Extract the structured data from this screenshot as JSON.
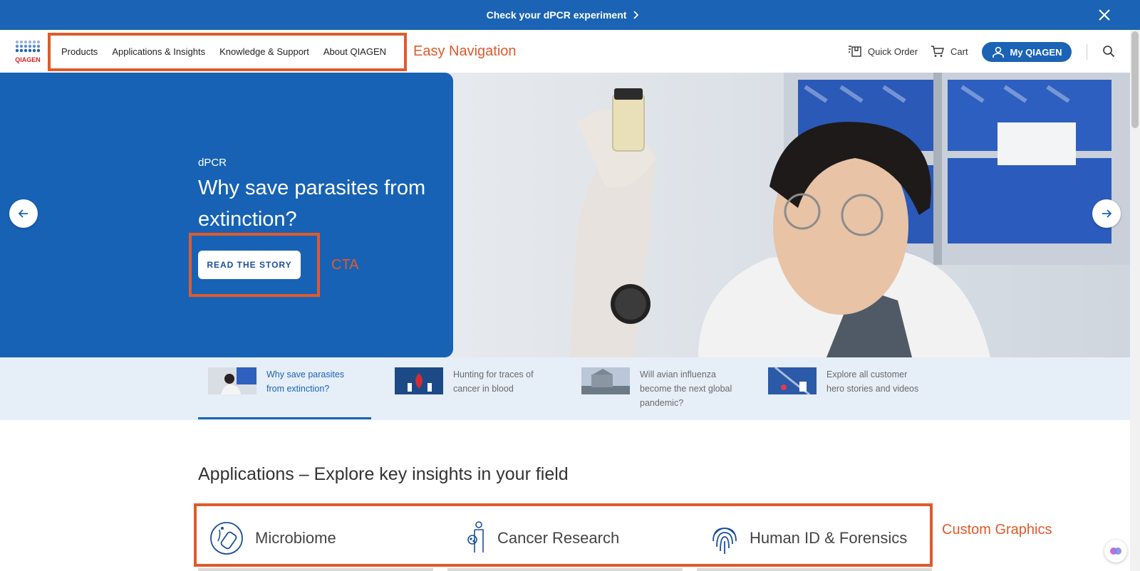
{
  "announcement": {
    "text": "Check your dPCR experiment"
  },
  "brand": {
    "logo_text": "QIAGEN",
    "primary": "#1b63b5",
    "annotation": "#e05a2b"
  },
  "nav": {
    "items": [
      {
        "label": "Products"
      },
      {
        "label": "Applications & Insights"
      },
      {
        "label": "Knowledge & Support"
      },
      {
        "label": "About QIAGEN"
      }
    ]
  },
  "header": {
    "quick_order": "Quick Order",
    "cart": "Cart",
    "my_account": "My QIAGEN"
  },
  "annotations": {
    "navigation": "Easy Navigation",
    "cta": "CTA",
    "graphics": "Custom Graphics"
  },
  "hero": {
    "tag": "dPCR",
    "title": "Why save parasites from extinction?",
    "cta_label": "READ THE STORY"
  },
  "thumbnails": [
    {
      "label": "Why save parasites from extinction?",
      "active": true
    },
    {
      "label": "Hunting for traces of cancer in blood",
      "active": false
    },
    {
      "label": "Will avian influenza become the next global pandemic?",
      "active": false
    },
    {
      "label": "Explore all customer hero stories and videos",
      "active": false
    }
  ],
  "applications": {
    "title": "Applications – Explore key insights in your field",
    "items": [
      {
        "label": "Microbiome",
        "icon": "microbiome-icon"
      },
      {
        "label": "Cancer Research",
        "icon": "cancer-research-icon"
      },
      {
        "label": "Human ID & Forensics",
        "icon": "fingerprint-icon"
      }
    ]
  }
}
